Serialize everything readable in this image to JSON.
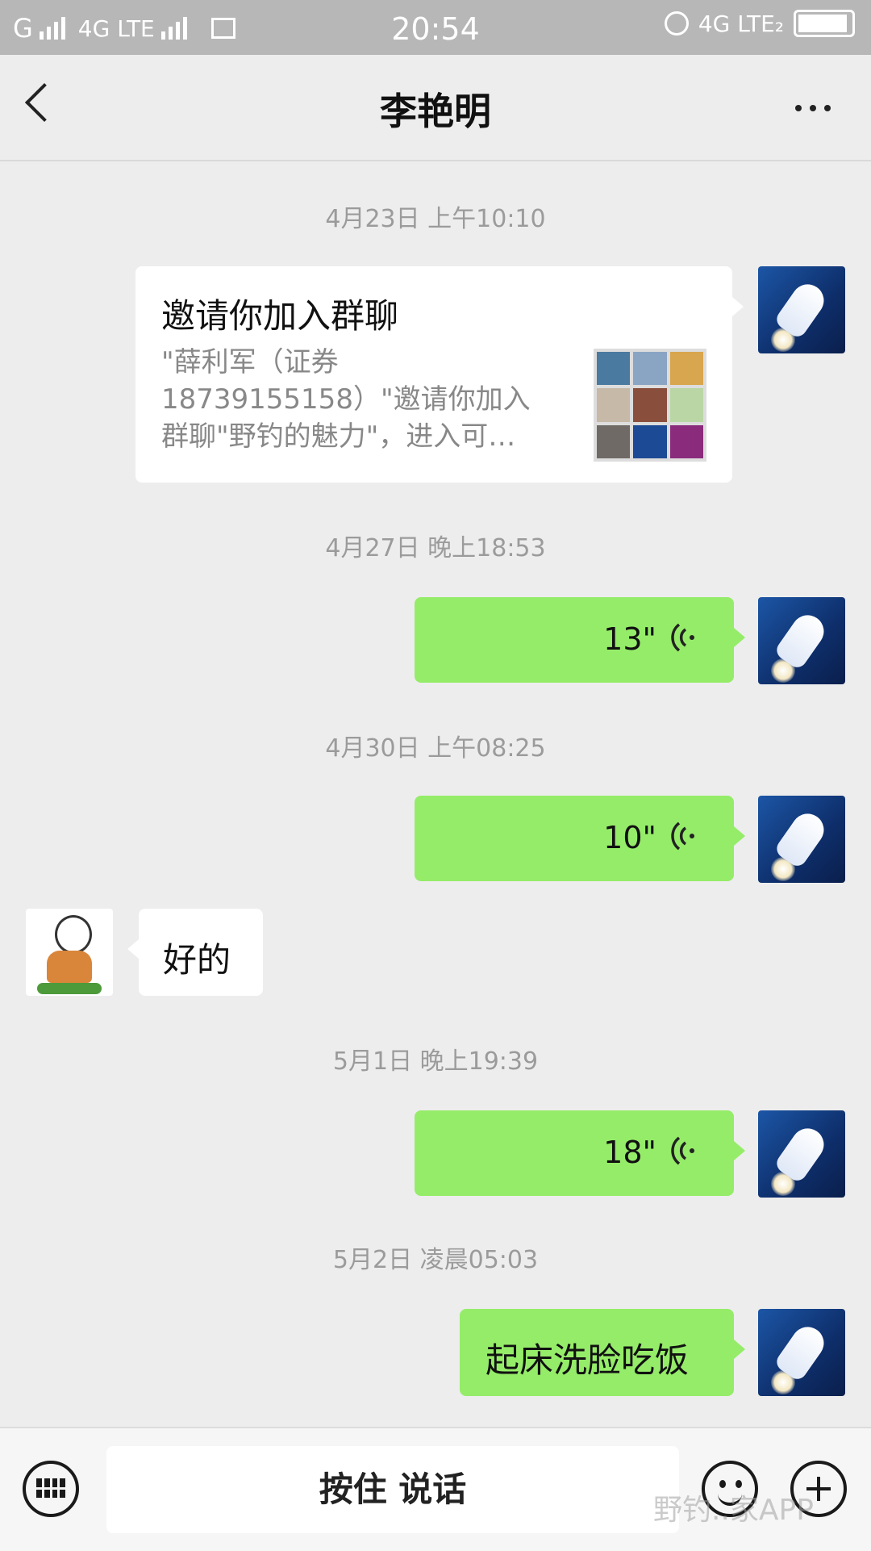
{
  "status_bar": {
    "carrier_left": "G",
    "network_1": "4G LTE",
    "time": "20:54",
    "network_2": "4G LTE₂"
  },
  "header": {
    "title": "李艳明"
  },
  "messages": [
    {
      "type": "timestamp",
      "text": "4月23日 上午10:10"
    },
    {
      "type": "invite",
      "title": "邀请你加入群聊",
      "description": "\"薛利军（证券18739155158）\"邀请你加入群聊\"野钓的魅力\"，进入可…"
    },
    {
      "type": "timestamp",
      "text": "4月27日 晚上18:53"
    },
    {
      "type": "voice",
      "duration": "13\""
    },
    {
      "type": "timestamp",
      "text": "4月30日 上午08:25"
    },
    {
      "type": "voice",
      "duration": "10\""
    },
    {
      "type": "text",
      "sender": "other",
      "text": "好的"
    },
    {
      "type": "timestamp",
      "text": "5月1日 晚上19:39"
    },
    {
      "type": "voice",
      "duration": "18\""
    },
    {
      "type": "timestamp",
      "text": "5月2日 凌晨05:03"
    },
    {
      "type": "text",
      "sender": "me",
      "text": "起床洗脸吃饭"
    }
  ],
  "bottom_bar": {
    "talk_label": "按住 说话",
    "watermark": "野钓..家APP"
  },
  "colors": {
    "bubble_me": "#95ec69",
    "bubble_other": "#ffffff",
    "background": "#ededed"
  },
  "icons": [
    "back-arrow-icon",
    "more-icon",
    "keyboard-icon",
    "emoji-icon",
    "plus-icon",
    "voice-wave-icon"
  ]
}
